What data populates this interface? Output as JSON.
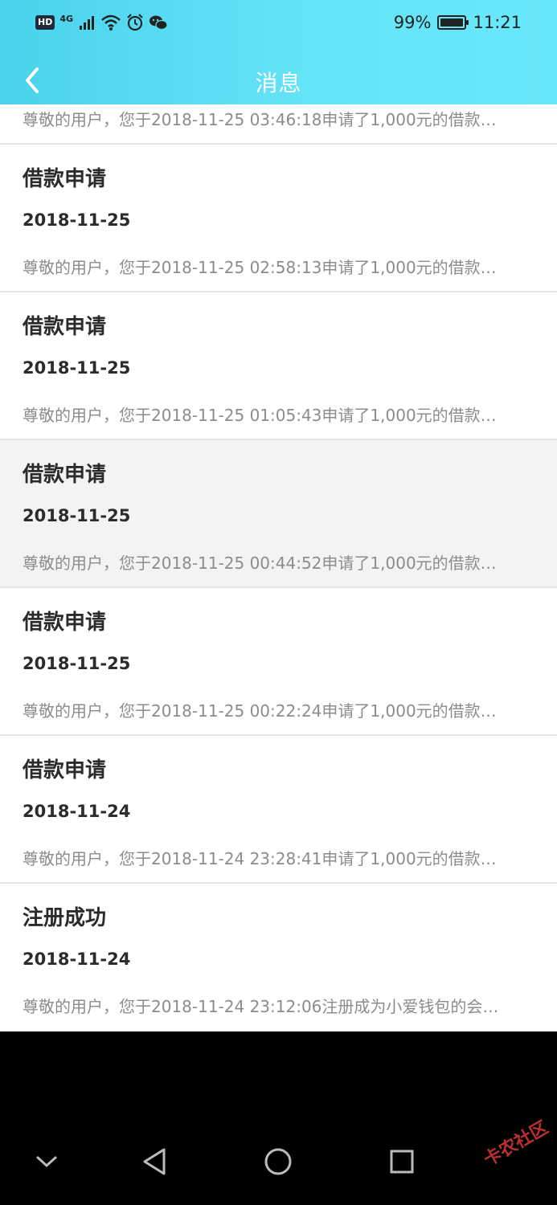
{
  "status_bar": {
    "hd": "HD",
    "network": "4G",
    "battery": "99%",
    "time": "11:21"
  },
  "header": {
    "title": "消息",
    "back_icon": "chevron-left-icon"
  },
  "colors": {
    "header_gradient_start": "#49d3ec",
    "header_gradient_end": "#6ae8fb",
    "title_text": "#2b2b2b",
    "body_text": "#8c8c8c",
    "active_row_bg": "#f3f3f3"
  },
  "messages": {
    "partial": {
      "body": "尊敬的用户，您于2018-11-25 03:46:18申请了1,000元的借款…"
    },
    "items": [
      {
        "title": "借款申请",
        "date": "2018-11-25",
        "body": "尊敬的用户，您于2018-11-25 02:58:13申请了1,000元的借款…"
      },
      {
        "title": "借款申请",
        "date": "2018-11-25",
        "body": "尊敬的用户，您于2018-11-25 01:05:43申请了1,000元的借款…"
      },
      {
        "title": "借款申请",
        "date": "2018-11-25",
        "body": "尊敬的用户，您于2018-11-25 00:44:52申请了1,000元的借款…"
      },
      {
        "title": "借款申请",
        "date": "2018-11-25",
        "body": "尊敬的用户，您于2018-11-25 00:22:24申请了1,000元的借款…"
      },
      {
        "title": "借款申请",
        "date": "2018-11-24",
        "body": "尊敬的用户，您于2018-11-24 23:28:41申请了1,000元的借款…"
      },
      {
        "title": "注册成功",
        "date": "2018-11-24",
        "body": "尊敬的用户，您于2018-11-24 23:12:06注册成为小爱钱包的会…"
      }
    ]
  },
  "nav": {
    "hide_icon": "chevron-down-icon",
    "back_icon": "triangle-back-icon",
    "home_icon": "circle-home-icon",
    "recents_icon": "square-recents-icon"
  },
  "watermark": "卡农社区"
}
